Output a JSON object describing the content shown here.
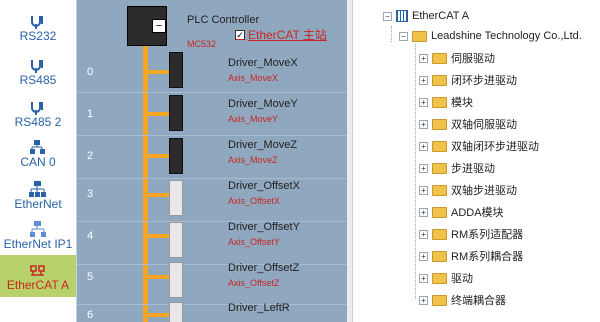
{
  "sidebar": {
    "items": [
      {
        "label": "RS232",
        "icon": "serial-port-icon",
        "active": false
      },
      {
        "label": "RS485",
        "icon": "serial-port-icon",
        "active": false
      },
      {
        "label": "RS485 2",
        "icon": "serial-port-icon",
        "active": false
      },
      {
        "label": "CAN 0",
        "icon": "can-bus-icon",
        "active": false
      },
      {
        "label": "EtherNet",
        "icon": "ethernet-icon",
        "active": false
      },
      {
        "label": "EtherNet IP1",
        "icon": "ethernet-ip-icon",
        "active": false
      },
      {
        "label": "EtherCAT A",
        "icon": "ethercat-icon",
        "active": true
      }
    ]
  },
  "topology": {
    "plc": {
      "title": "PLC Controller",
      "model": "MC532",
      "master_label": "EtherCAT 主站",
      "master_checked": true
    },
    "rows": [
      {
        "index": "0",
        "name": "Driver_MoveX",
        "axis": "Axis_MoveX"
      },
      {
        "index": "1",
        "name": "Driver_MoveY",
        "axis": "Axis_MoveY"
      },
      {
        "index": "2",
        "name": "Driver_MoveZ",
        "axis": "Axis_MoveZ"
      },
      {
        "index": "3",
        "name": "Driver_OffsetX",
        "axis": "Axis_OffsetX"
      },
      {
        "index": "4",
        "name": "Driver_OffsetY",
        "axis": "Axis_OffsetY"
      },
      {
        "index": "5",
        "name": "Driver_OffsetZ",
        "axis": "Axis_OffsetZ"
      },
      {
        "index": "6",
        "name": "Driver_LeftR",
        "axis": ""
      }
    ]
  },
  "tree": {
    "root": "EtherCAT A",
    "vendor": "Leadshine Technology Co.,Ltd.",
    "categories": [
      "伺服驱动",
      "闭环步进驱动",
      "模块",
      "双轴伺服驱动",
      "双轴闭环步进驱动",
      "步进驱动",
      "双轴步进驱动",
      "ADDA模块",
      "RM系列适配器",
      "RM系列耦合器",
      "驱动",
      "终端耦合器"
    ]
  },
  "colors": {
    "accent": "#2a62a8",
    "active_bg": "#b7d26a",
    "bus": "#f5a623",
    "label_red": "#c8261f"
  }
}
